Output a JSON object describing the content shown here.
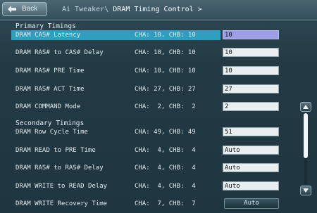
{
  "header": {
    "back_label": "Back",
    "breadcrumb_parent": "Ai Tweaker\\",
    "breadcrumb_current": "DRAM Timing Control >",
    "back_icon": "back-arrow-icon"
  },
  "sections": {
    "primary": "Primary Timings",
    "secondary": "Secondary Timings"
  },
  "rows": [
    {
      "label": "DRAM CAS# Latency",
      "channels": "CHA: 10, CHB: 10",
      "value": "10",
      "kind": "input",
      "selected": true
    },
    {
      "label": "DRAM RAS# to CAS# Delay",
      "channels": "CHA: 10, CHB: 10",
      "value": "10",
      "kind": "input"
    },
    {
      "label": "DRAM RAS# PRE Time",
      "channels": "CHA: 10, CHB: 10",
      "value": "10",
      "kind": "input"
    },
    {
      "label": "DRAM RAS# ACT Time",
      "channels": "CHA: 27, CHB: 27",
      "value": "27",
      "kind": "input"
    },
    {
      "label": "DRAM COMMAND Mode",
      "channels": "CHA:  2, CHB:  2",
      "value": "2",
      "kind": "input"
    },
    {
      "label": "DRAM Row Cycle Time",
      "channels": "CHA: 49, CHB: 49",
      "value": "51",
      "kind": "input"
    },
    {
      "label": "DRAM READ to PRE Time",
      "channels": "CHA:  4, CHB:  4",
      "value": "Auto",
      "kind": "input"
    },
    {
      "label": "DRAM RAS# to RAS# Delay",
      "channels": "CHA:  4, CHB:  4",
      "value": "Auto",
      "kind": "input"
    },
    {
      "label": "DRAM WRITE to READ Delay",
      "channels": "CHA:  4, CHB:  4",
      "value": "Auto",
      "kind": "input"
    },
    {
      "label": "DRAM WRITE Recovery Time",
      "channels": "CHA:  7, CHB:  7",
      "value": "Auto",
      "kind": "button"
    }
  ],
  "scrollbar": {
    "up_icon": "scroll-up-icon",
    "down_icon": "scroll-down-icon"
  },
  "colors": {
    "selection": "#2f9fbf",
    "selected_input": "#9c9ee6",
    "background": "#223a45"
  }
}
